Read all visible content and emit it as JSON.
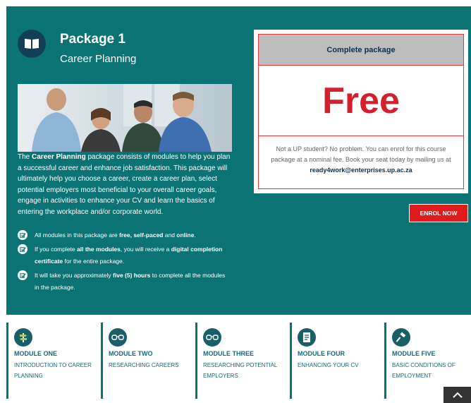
{
  "package": {
    "title": "Package 1",
    "subtitle": "Career Planning",
    "icon": "book-icon"
  },
  "description": {
    "pre": "The ",
    "strong": "Career Planning",
    "post": " package consists of modules to help you plan a successful career and enhance job satisfaction. This package will ultimately help you choose a career, create a career plan, select potential employers most beneficial to your overall career goals, engage in activities to enhance your CV and learn the basics of entering the workplace and/or corporate world."
  },
  "features": [
    {
      "t1": "All modules in this package are ",
      "b1": "free, self-paced",
      "t2": " and ",
      "b2": "online",
      "t3": ".",
      "b3": "",
      "t4": ""
    },
    {
      "t1": "If you complete ",
      "b1": "all the modules",
      "t2": ", you will receive a ",
      "b2": "digital completion certificate",
      "t3": " for the entire package.",
      "b3": "",
      "t4": ""
    },
    {
      "t1": "It will take you approximately ",
      "b1": "five (5) hours",
      "t2": " to complete all the modules in the package.",
      "b2": "",
      "t3": "",
      "b3": "",
      "t4": ""
    }
  ],
  "card": {
    "header": "Complete package",
    "price": "Free",
    "note": "Not a UP student? No problem. You can enrol for this course package at a nominal fee. Book your seat today by mailing us at ",
    "email": "ready4work@enterprises.up.ac.za"
  },
  "enrol_label": "ENROL NOW",
  "modules": [
    {
      "title": "MODULE ONE",
      "text": "INTRODUCTION TO CAREER PLANNING",
      "icon": "signpost-icon"
    },
    {
      "title": "MODULE TWO",
      "text": "RESEARCHING CAREERS",
      "icon": "glasses-icon"
    },
    {
      "title": "MODULE THREE",
      "text": "RESEARCHING POTENTIAL EMPLOYERS",
      "icon": "glasses-icon"
    },
    {
      "title": "MODULE FOUR",
      "text": "ENHANCING YOUR CV",
      "icon": "document-icon"
    },
    {
      "title": "MODULE FIVE",
      "text": "BASIC CONDITIONS OF EMPLOYMENT",
      "icon": "gavel-icon"
    }
  ],
  "colors": {
    "teal": "#0b7374",
    "red": "#e01b1b",
    "navy": "#123e56"
  }
}
